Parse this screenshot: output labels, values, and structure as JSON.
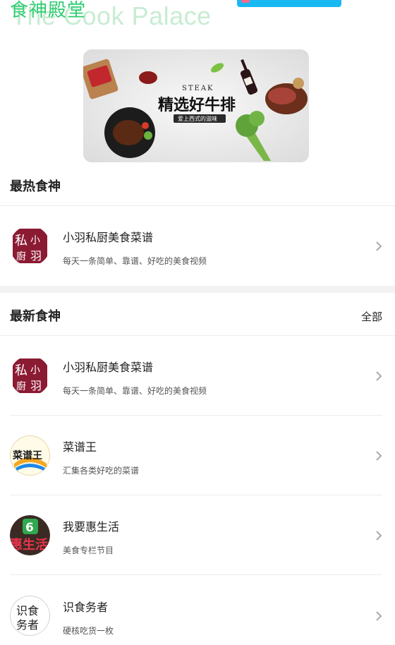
{
  "header": {
    "title_cn": "食神殿堂",
    "title_en": "The Cook Palace"
  },
  "banner": {
    "label_en": "STEAK",
    "label_cn": "精选好牛排",
    "tagline": "爱上西式的滋味"
  },
  "hot_section": {
    "title": "最热食神",
    "items": [
      {
        "name": "小羽私厨美食菜谱",
        "desc": "每天一条简单、靠谱、好吃的美食视频",
        "avatar_icon": "xiaoyu-kitchen-logo"
      }
    ]
  },
  "new_section": {
    "title": "最新食神",
    "more_label": "全部",
    "items": [
      {
        "name": "小羽私厨美食菜谱",
        "desc": "每天一条简单、靠谱、好吃的美食视频",
        "avatar_icon": "xiaoyu-kitchen-logo"
      },
      {
        "name": "菜谱王",
        "desc": "汇集各类好吃的菜谱",
        "avatar_icon": "recipe-king-logo"
      },
      {
        "name": "我要惠生活",
        "desc": "美食专栏节目",
        "avatar_icon": "huishenghuo-logo"
      },
      {
        "name": "识食务者",
        "desc": "硬核吃货一枚",
        "avatar_icon": "shishiwuzhe-logo"
      }
    ]
  },
  "colors": {
    "accent_green": "#2ecc71",
    "faint_green": "#c8ecd2",
    "badge_blue": "#18b9f3"
  }
}
